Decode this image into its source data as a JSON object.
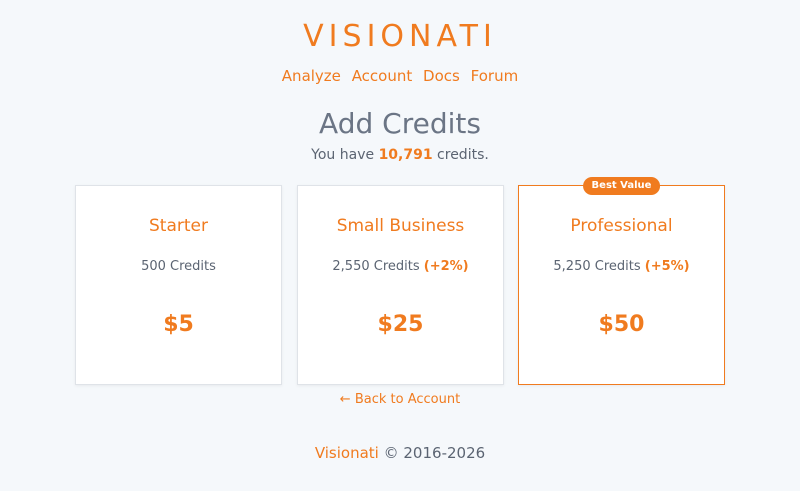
{
  "brand": {
    "logo_text": "VISIONATI",
    "accent_color": "#f07b1f"
  },
  "nav": {
    "items": [
      {
        "label": "Analyze"
      },
      {
        "label": "Account"
      },
      {
        "label": "Docs"
      },
      {
        "label": "Forum"
      }
    ]
  },
  "page": {
    "title": "Add Credits",
    "credits_prefix": "You have",
    "credits_count": "10,791",
    "credits_suffix": "credits."
  },
  "plans": [
    {
      "name": "Starter",
      "amount": "500 Credits",
      "bonus": "",
      "price": "$5"
    },
    {
      "name": "Small Business",
      "amount": "2,550 Credits",
      "bonus": "(+2%)",
      "price": "$25"
    },
    {
      "name": "Professional",
      "amount": "5,250 Credits",
      "bonus": "(+5%)",
      "price": "$50",
      "badge": "Best Value"
    }
  ],
  "back_link": {
    "arrow": "←",
    "label": "Back to Account"
  },
  "footer": {
    "brand_link": "Visionati",
    "copyright": "© 2016-2026"
  }
}
